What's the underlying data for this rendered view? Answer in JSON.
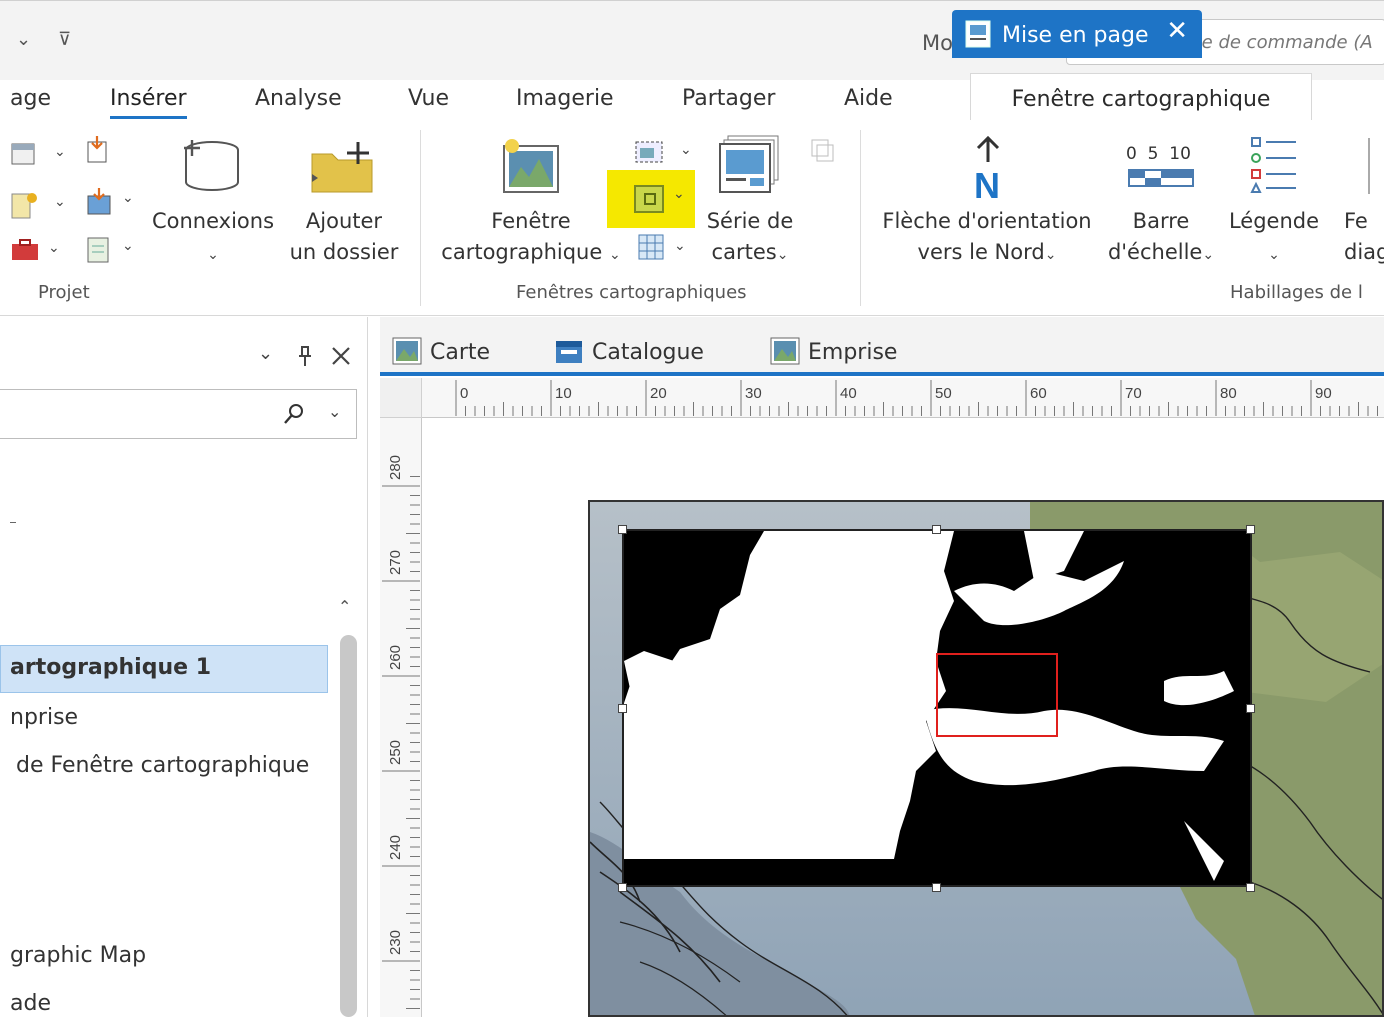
{
  "quick_access": {
    "dropdown_glyph": "⌄",
    "customize_glyph": "⊽"
  },
  "header": {
    "project_name": "Mon projet",
    "search_placeholder": "Recherche de commande (A"
  },
  "ribbon_tabs": [
    "age",
    "Insérer",
    "Analyse",
    "Vue",
    "Imagerie",
    "Partager",
    "Aide"
  ],
  "active_ribbon_tab": "Insérer",
  "contextual_tab": "Fenêtre cartographique",
  "groups": {
    "projet": {
      "label": "Projet",
      "connexions_label": "Connexions",
      "ajouter_dossier_line1": "Ajouter",
      "ajouter_dossier_line2": "un dossier"
    },
    "fenetres": {
      "label": "Fenêtres cartographiques",
      "fenetre_line1": "Fenêtre",
      "fenetre_line2": "cartographique",
      "serie_line1": "Série de",
      "serie_line2": "cartes"
    },
    "habillages": {
      "label": "Habillages de l",
      "fleche_line1": "Flèche d'orientation",
      "fleche_line2": "vers le Nord",
      "barre_line1": "Barre",
      "barre_line2": "d'échelle",
      "legende_label": "Légende",
      "fe_line1": "Fe",
      "fe_line2": "diag",
      "scale_numbers": "0  5  10",
      "north_letter": "N"
    }
  },
  "left_pane": {
    "tree_items": [
      "artographique 1",
      "nprise",
      "de Fenêtre cartographique",
      "graphic Map",
      "ade"
    ]
  },
  "view_tabs": [
    "Carte",
    "Catalogue",
    "Emprise"
  ],
  "active_view_tab": "Mise en page",
  "ruler_top_labels": [
    "0",
    "10",
    "20",
    "30",
    "40",
    "50",
    "60",
    "70",
    "80",
    "90"
  ],
  "ruler_left_labels": [
    "280",
    "270",
    "260",
    "250",
    "240",
    "230"
  ],
  "colors": {
    "accent": "#1e74c6",
    "highlight": "#f5e800",
    "extent_outline": "#e0201d",
    "selection": "#cfe3f7"
  }
}
